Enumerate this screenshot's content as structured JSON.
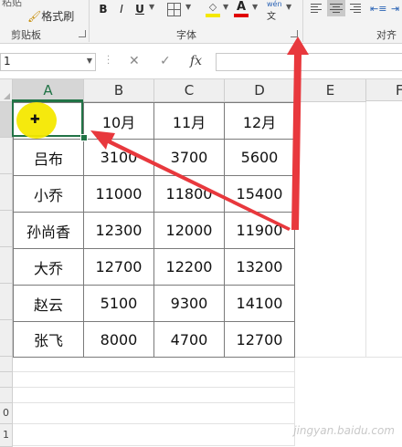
{
  "ribbon": {
    "clipboard": {
      "paste_label": "粘贴",
      "format_painter_label": "格式刷",
      "group_label": "剪贴板"
    },
    "font": {
      "group_label": "字体",
      "bold": "B",
      "italic": "I",
      "underline": "U",
      "font_color": "A",
      "phonetic": "wén"
    },
    "alignment": {
      "group_label": "对齐方"
    }
  },
  "formula_bar": {
    "name_box_value": "1",
    "cancel_symbol": "✕",
    "enter_symbol": "✓",
    "fx_label": "fx",
    "formula_value": ""
  },
  "columns": [
    "A",
    "B",
    "C",
    "D",
    "E",
    "F"
  ],
  "rows": [
    "",
    "",
    "",
    "",
    "",
    "",
    "",
    "",
    "",
    "",
    "0",
    "1"
  ],
  "table": {
    "header": [
      "",
      "10月",
      "11月",
      "12月"
    ],
    "rows": [
      [
        "吕布",
        "3100",
        "3700",
        "5600"
      ],
      [
        "小乔",
        "11000",
        "11800",
        "15400"
      ],
      [
        "孙尚香",
        "12300",
        "12000",
        "11900"
      ],
      [
        "大乔",
        "12700",
        "12200",
        "13200"
      ],
      [
        "赵云",
        "5100",
        "9300",
        "14100"
      ],
      [
        "张飞",
        "8000",
        "4700",
        "12700"
      ]
    ]
  },
  "watermark": "jingyan.baidu.com",
  "colors": {
    "selection": "#217346",
    "highlight": "#f4e800",
    "arrow": "#e8383d"
  }
}
